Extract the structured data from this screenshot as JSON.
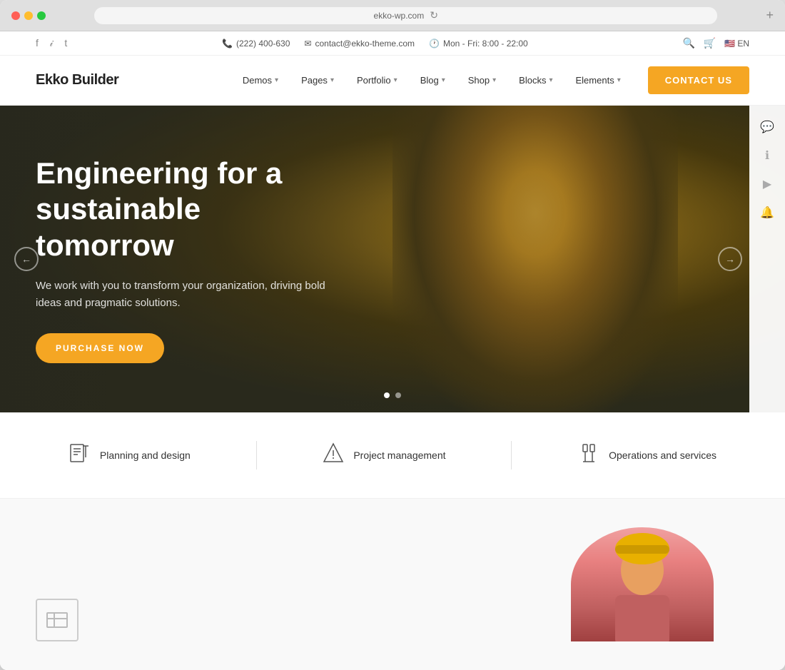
{
  "browser": {
    "url": "ekko-wp.com",
    "add_tab": "+"
  },
  "topbar": {
    "phone": "(222) 400-630",
    "email": "contact@ekko-theme.com",
    "hours": "Mon - Fri: 8:00 - 22:00",
    "lang": "EN"
  },
  "nav": {
    "logo": "Ekko Builder",
    "items": [
      {
        "label": "Demos",
        "has_arrow": true
      },
      {
        "label": "Pages",
        "has_arrow": true
      },
      {
        "label": "Portfolio",
        "has_arrow": true
      },
      {
        "label": "Blog",
        "has_arrow": true
      },
      {
        "label": "Shop",
        "has_arrow": true
      },
      {
        "label": "Blocks",
        "has_arrow": true
      },
      {
        "label": "Elements",
        "has_arrow": true
      }
    ],
    "contact_btn": "Contact US"
  },
  "hero": {
    "title": "Engineering for a sustainable tomorrow",
    "subtitle": "We work with you to transform your organization, driving bold ideas and pragmatic solutions.",
    "cta_label": "PURCHASE NOW",
    "arrow_left": "←",
    "arrow_right": "→",
    "dots": [
      {
        "active": true
      },
      {
        "active": false
      }
    ]
  },
  "services": [
    {
      "icon": "🏗",
      "label": "Planning and design"
    },
    {
      "icon": "⚙",
      "label": "Project management"
    },
    {
      "icon": "🔧",
      "label": "Operations and services"
    }
  ],
  "sidebar_icons": [
    {
      "name": "comment-icon",
      "glyph": "💬"
    },
    {
      "name": "info-icon",
      "glyph": "ℹ"
    },
    {
      "name": "play-icon",
      "glyph": "▶"
    },
    {
      "name": "bell-icon",
      "glyph": "🔔"
    }
  ],
  "colors": {
    "accent": "#f5a623",
    "dark": "#222",
    "light_gray": "#f5f5f5"
  }
}
